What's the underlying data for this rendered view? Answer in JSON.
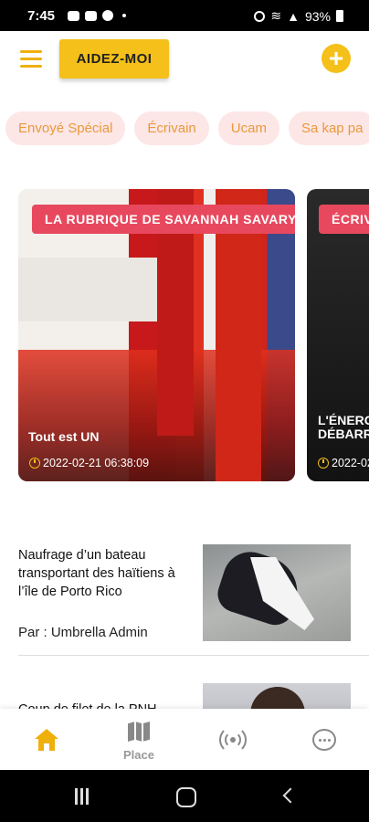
{
  "status_bar": {
    "time": "7:45",
    "battery": "93%"
  },
  "header": {
    "help_label": "AIDEZ-MOI",
    "add_label": "+"
  },
  "categories": [
    "Envoyé Spécial",
    "Écrivain",
    "Ucam",
    "Sa kap pa"
  ],
  "featured": [
    {
      "tag": "LA RUBRIQUE DE SAVANNAH SAVARY",
      "title": "Tout est UN",
      "date": "2022-02-21 06:38:09"
    },
    {
      "tag": "ÉCRIV",
      "title": "L'ÉNERG DÉBARRA",
      "date": "2022-02"
    }
  ],
  "news": [
    {
      "title": "Naufrage d’un bateau transportant des haïtiens à l’île de Porto Rico",
      "author": "Par : Umbrella Admin"
    },
    {
      "title": "Coup de filet de la PNH"
    }
  ],
  "bottom_nav": {
    "place_label": "Place"
  },
  "colors": {
    "accent": "#f4c019",
    "chip_bg": "#fde6e6",
    "chip_text": "#e89a3c",
    "tag_bg": "#e8485e"
  }
}
